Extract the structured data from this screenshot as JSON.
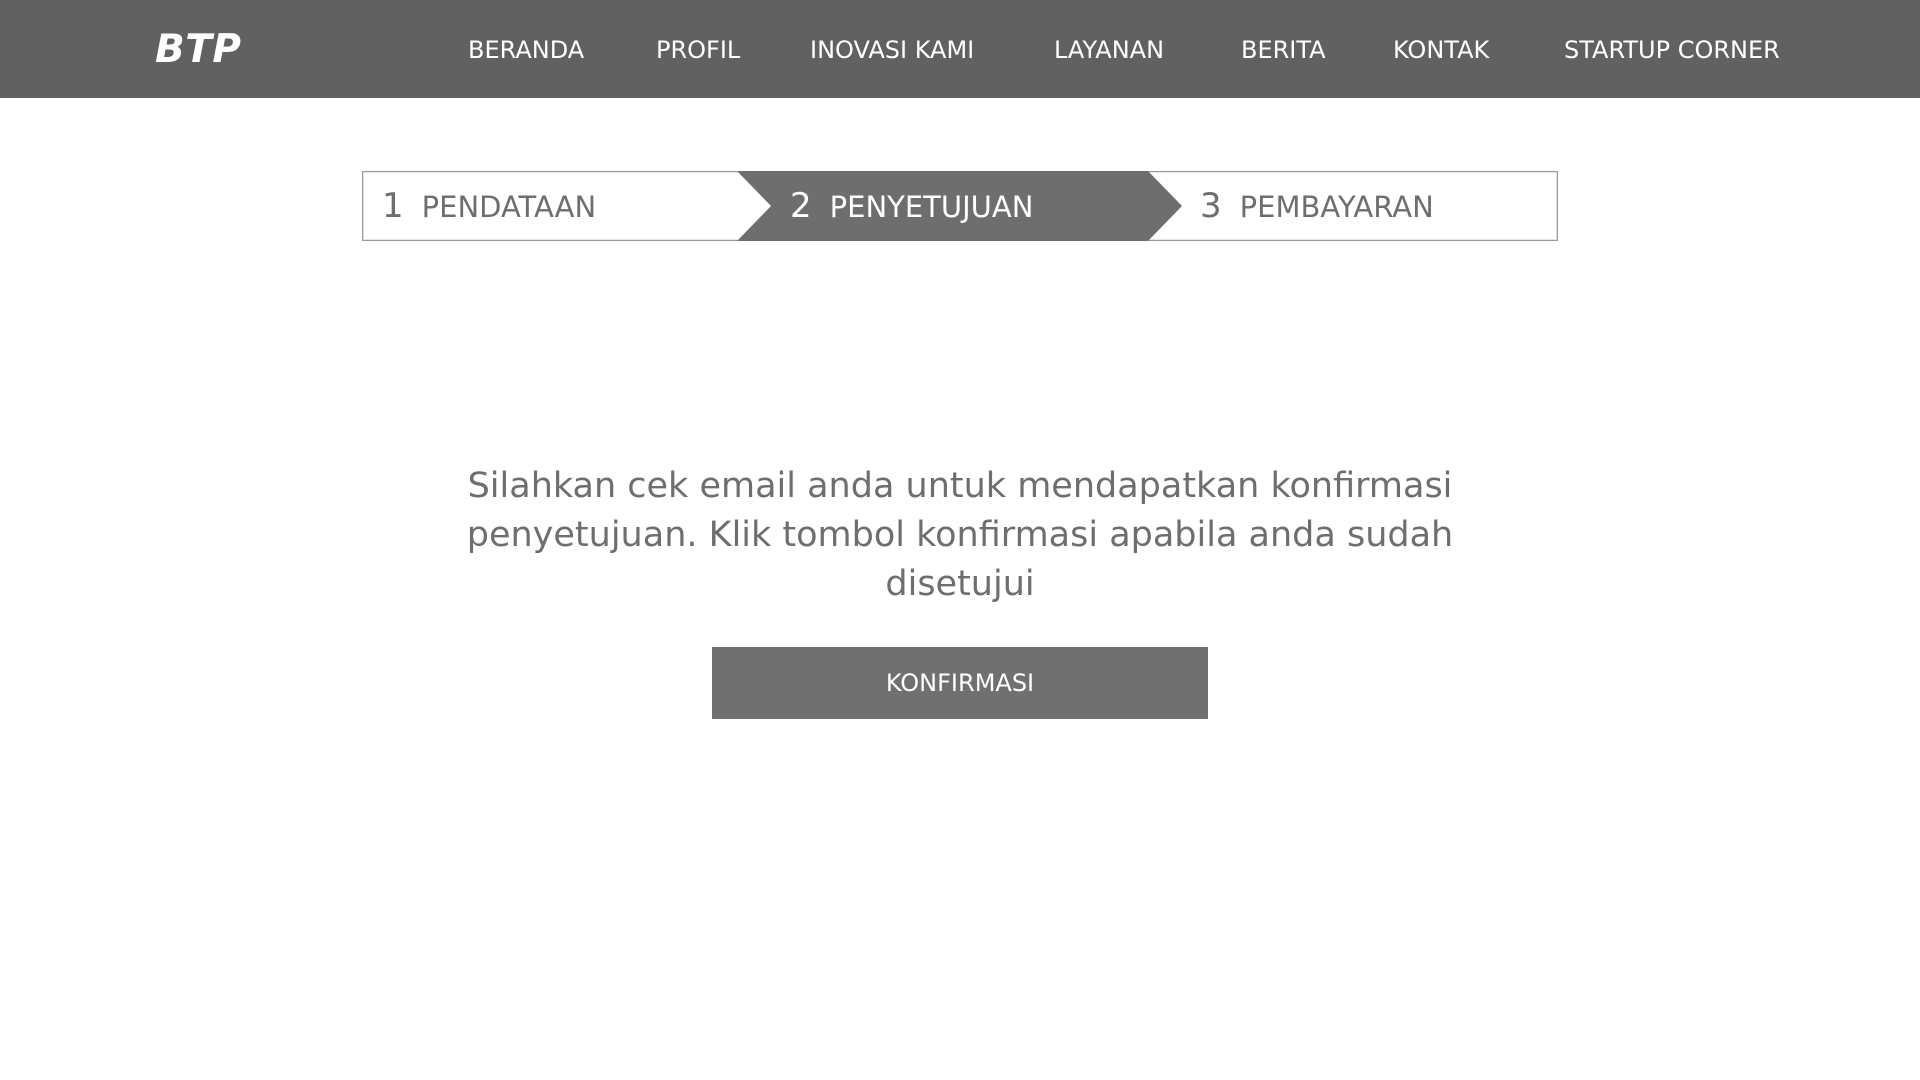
{
  "header": {
    "logo": "BTP",
    "nav": [
      {
        "label": "BERANDA"
      },
      {
        "label": "PROFIL"
      },
      {
        "label": "INOVASI KAMI"
      },
      {
        "label": "LAYANAN"
      },
      {
        "label": "BERITA"
      },
      {
        "label": "KONTAK"
      },
      {
        "label": "STARTUP CORNER"
      }
    ]
  },
  "stepper": {
    "active_step": 2,
    "steps": [
      {
        "number": "1",
        "label": "PENDATAAN"
      },
      {
        "number": "2",
        "label": "PENYETUJUAN"
      },
      {
        "number": "3",
        "label": "PEMBAYARAN"
      }
    ]
  },
  "main": {
    "message": "Silahkan cek email anda untuk mendapatkan konfirmasi penyetujuan. Klik tombol konfirmasi apabila anda sudah disetujui",
    "confirm_label": "KONFIRMASI"
  },
  "colors": {
    "header_bg": "#616161",
    "active_step_bg": "#6e6e6e",
    "button_bg": "#707070",
    "text_gray": "#6e6e6e"
  }
}
